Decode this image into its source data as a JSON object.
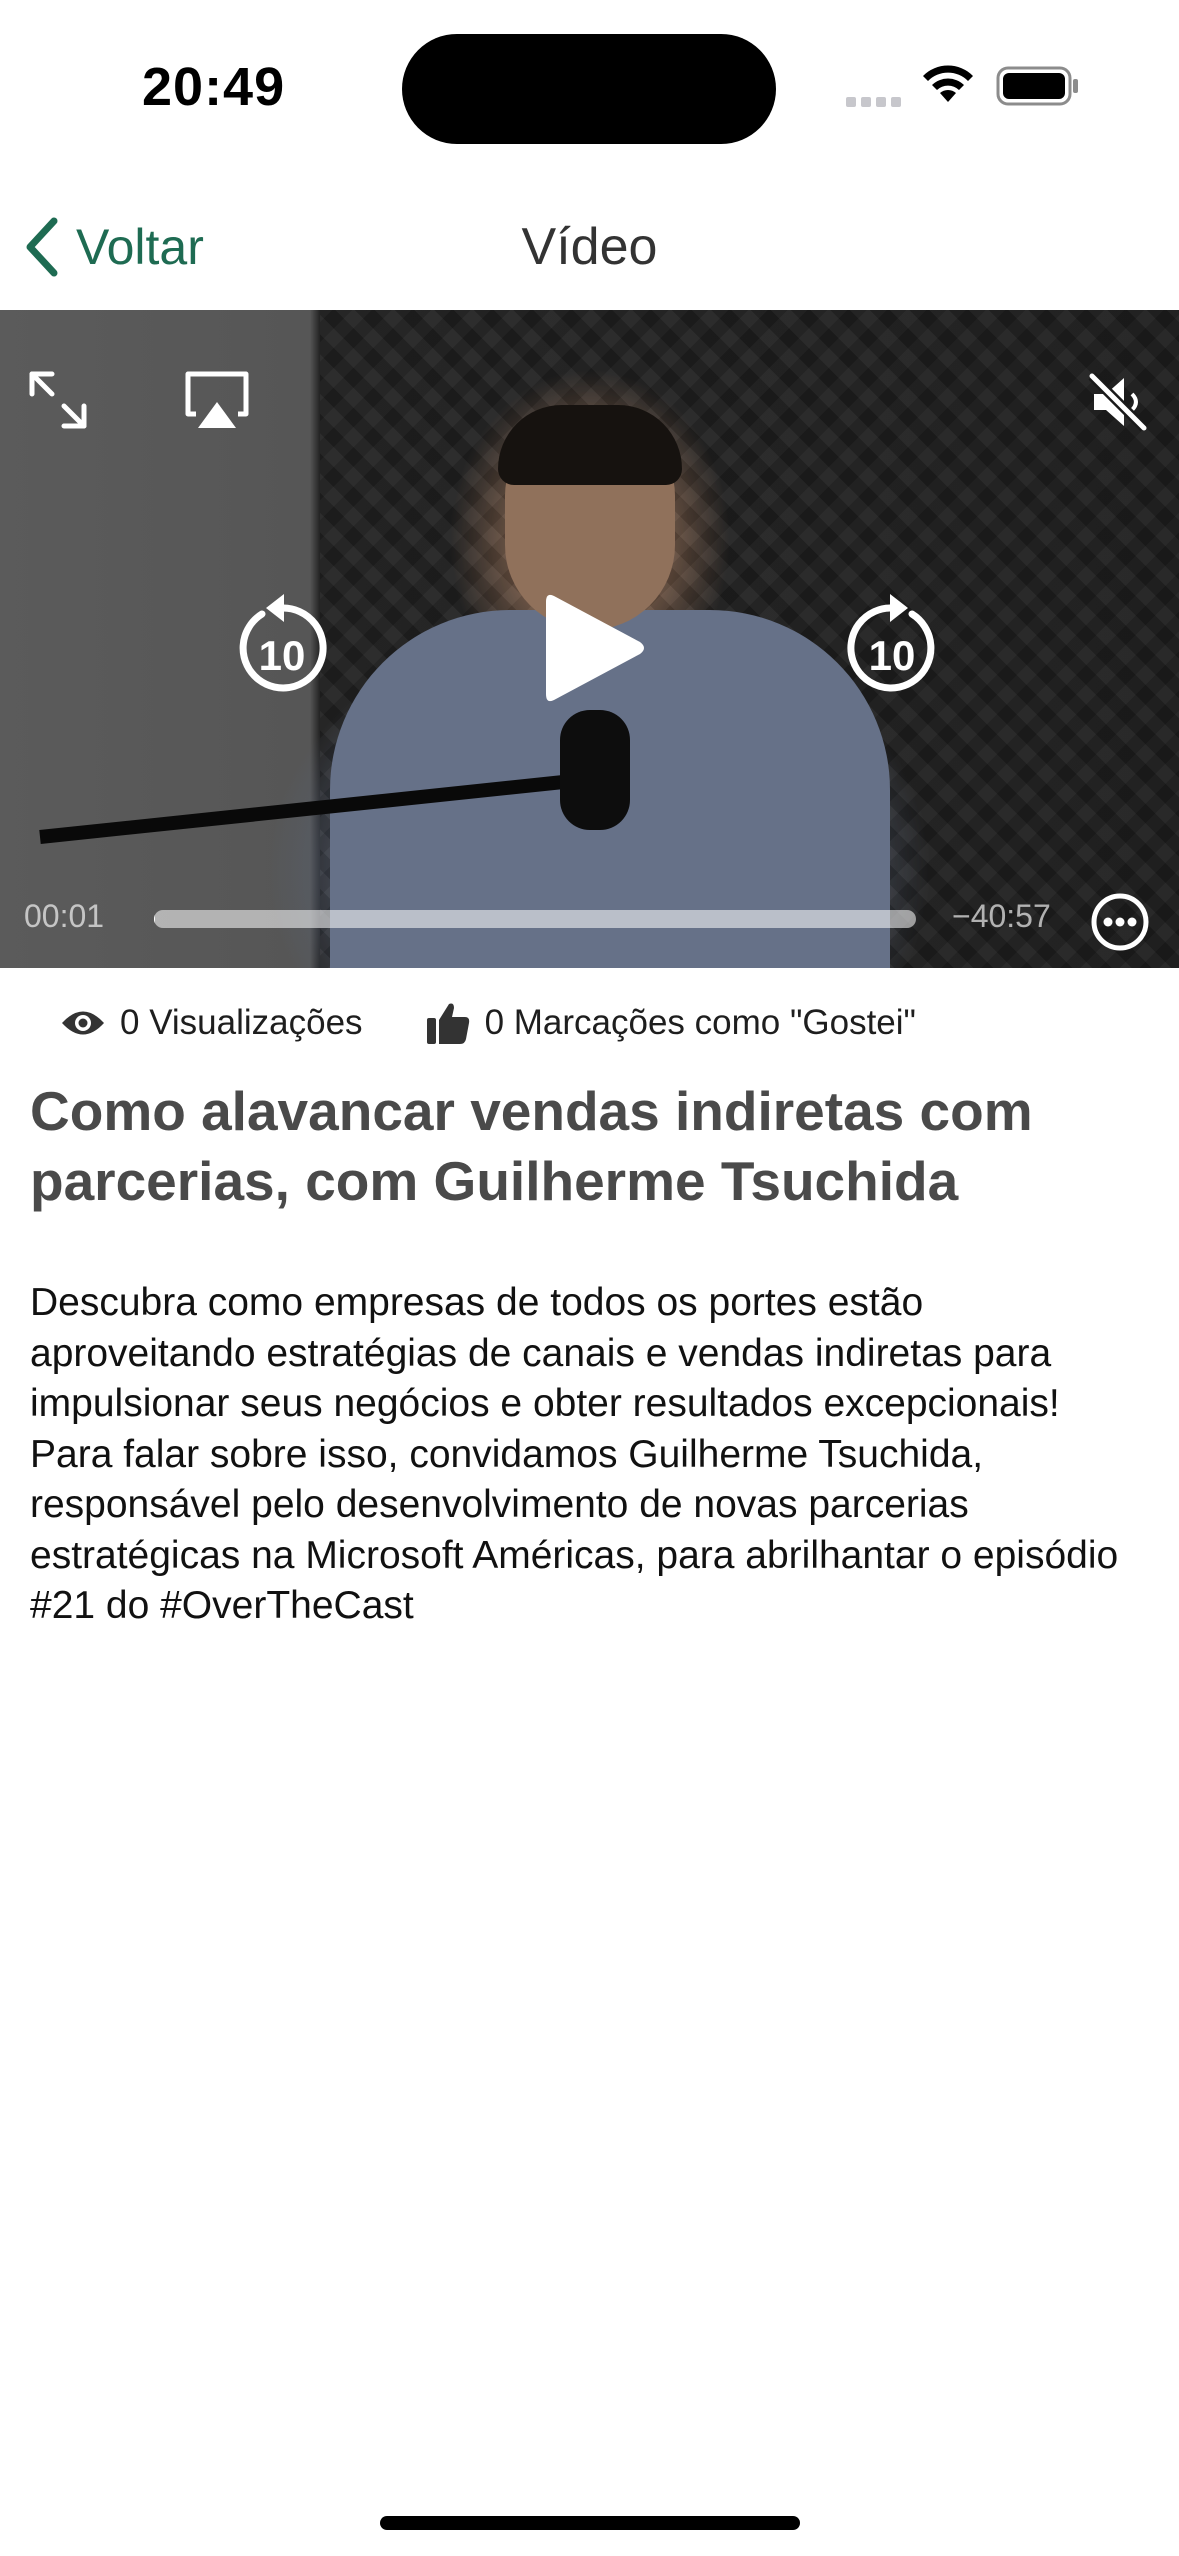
{
  "status_bar": {
    "time": "20:49"
  },
  "nav": {
    "back_label": "Voltar",
    "title": "Vídeo",
    "accent_color": "#1e6b52"
  },
  "video": {
    "current_time": "00:01",
    "remaining_time": "−40:57",
    "progress_fraction": 0.0004,
    "skip_back_seconds": "10",
    "skip_forward_seconds": "10",
    "controls": [
      "fullscreen-icon",
      "airplay-icon",
      "mute-icon",
      "rewind-10-icon",
      "play-icon",
      "forward-10-icon",
      "more-options-icon"
    ]
  },
  "stats": {
    "views_label": "0 Visualizações",
    "likes_label": "0 Marcações como \"Gostei\""
  },
  "content": {
    "title": "Como alavancar vendas indiretas com parcerias, com Guilherme Tsuchida",
    "description": "Descubra como empresas de todos os portes estão aproveitando estratégias de canais e vendas indiretas para impulsionar seus negócios e obter resultados excepcionais! Para falar sobre isso, convidamos Guilherme Tsuchida, responsável pelo desenvolvimento de novas parcerias estratégicas na Microsoft Américas, para abrilhantar o episódio #21 do #OverTheCast"
  }
}
